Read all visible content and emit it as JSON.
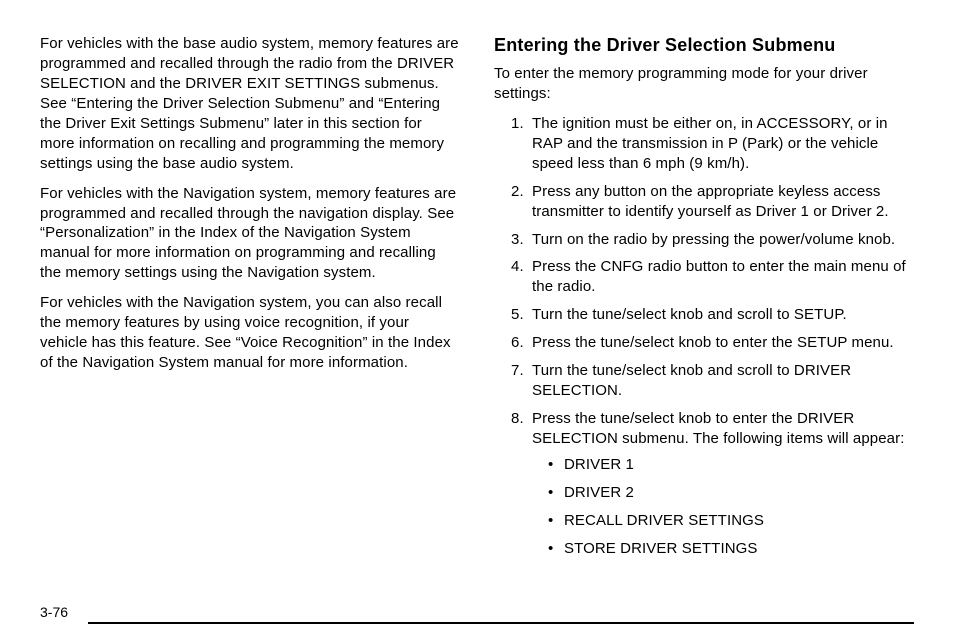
{
  "pageNumber": "3-76",
  "left": {
    "p1": "For vehicles with the base audio system, memory features are programmed and recalled through the radio from the DRIVER SELECTION and the DRIVER EXIT SETTINGS submenus. See “Entering the Driver Selection Submenu” and “Entering the Driver Exit Settings Submenu” later in this section for more information on recalling and programming the memory settings using the base audio system.",
    "p2": "For vehicles with the Navigation system, memory features are programmed and recalled through the navigation display. See “Personalization” in the Index of the Navigation System manual for more information on programming and recalling the memory settings using the Navigation system.",
    "p3": "For vehicles with the Navigation system, you can also recall the memory features by using voice recognition, if your vehicle has this feature. See “Voice Recognition” in the Index of the Navigation System manual for more information."
  },
  "right": {
    "heading": "Entering the Driver Selection Submenu",
    "intro": "To enter the memory programming mode for your driver settings:",
    "steps": [
      "The ignition must be either on, in ACCESSORY, or in RAP and the transmission in P (Park) or the vehicle speed less than 6 mph (9 km/h).",
      "Press any button on the appropriate keyless access transmitter to identify yourself as Driver 1 or Driver 2.",
      "Turn on the radio by pressing the power/volume knob.",
      "Press the CNFG radio button to enter the main menu of the radio.",
      "Turn the tune/select knob and scroll to SETUP.",
      "Press the tune/select knob to enter the SETUP menu.",
      "Turn the tune/select knob and scroll to DRIVER SELECTION.",
      "Press the tune/select knob to enter the DRIVER SELECTION submenu. The following items will appear:"
    ],
    "bullets": [
      "DRIVER 1",
      "DRIVER 2",
      "RECALL DRIVER SETTINGS",
      "STORE DRIVER SETTINGS"
    ]
  }
}
